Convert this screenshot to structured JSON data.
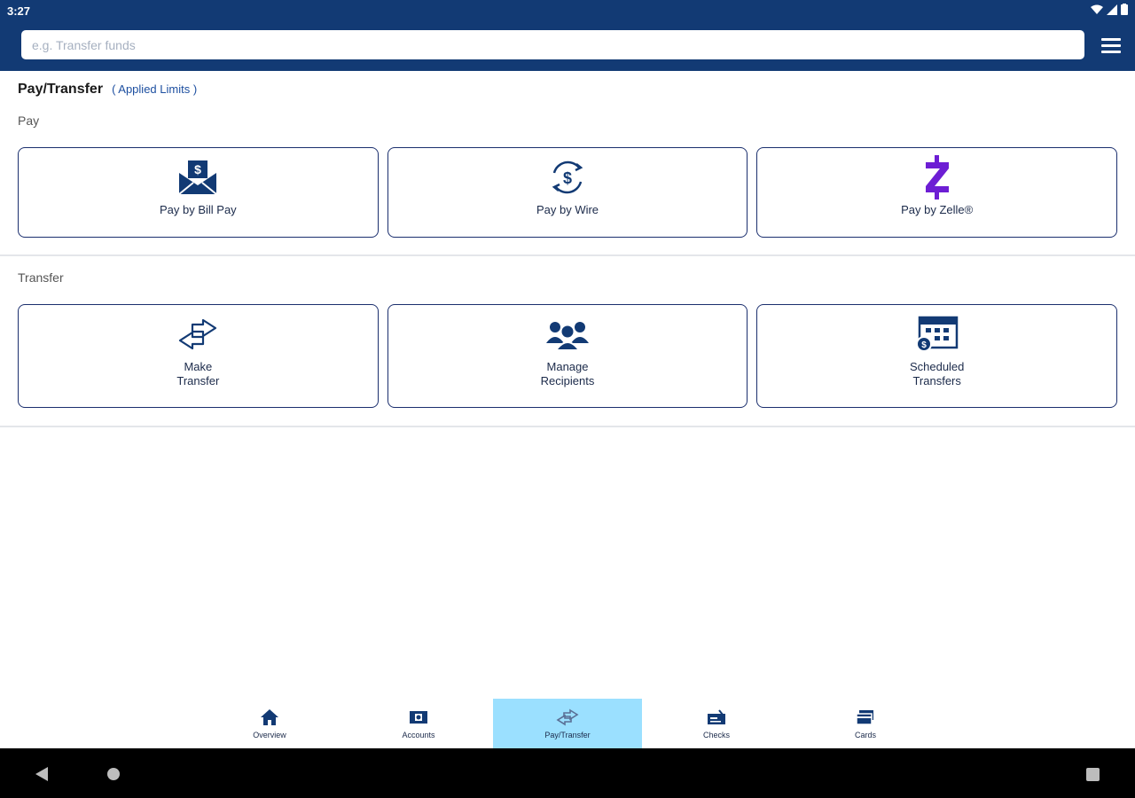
{
  "status_bar": {
    "time": "3:27"
  },
  "search": {
    "placeholder": "e.g. Transfer funds",
    "value": ""
  },
  "header": {
    "title": "Pay/Transfer",
    "limits_link": "( Applied Limits )"
  },
  "pay_section": {
    "label": "Pay",
    "tiles": [
      {
        "label": "Pay by Bill Pay",
        "icon": "bill-pay-envelope-icon"
      },
      {
        "label": "Pay by Wire",
        "icon": "wire-dollar-icon"
      },
      {
        "label": "Pay by Zelle®",
        "icon": "zelle-icon"
      }
    ]
  },
  "transfer_section": {
    "label": "Transfer",
    "tiles": [
      {
        "label": "Make\nTransfer",
        "icon": "transfer-arrows-icon"
      },
      {
        "label": "Manage\nRecipients",
        "icon": "recipients-icon"
      },
      {
        "label": "Scheduled\nTransfers",
        "icon": "calendar-icon"
      }
    ]
  },
  "bottom_nav": {
    "items": [
      {
        "label": "Overview",
        "icon": "home-icon"
      },
      {
        "label": "Accounts",
        "icon": "accounts-icon"
      },
      {
        "label": "Pay/Transfer",
        "icon": "pay-transfer-icon",
        "active": true
      },
      {
        "label": "Checks",
        "icon": "checks-icon"
      },
      {
        "label": "Cards",
        "icon": "cards-icon"
      }
    ]
  },
  "colors": {
    "brand": "#123a74",
    "tile_border": "#1b2f6e",
    "zelle": "#6d1ed4",
    "link": "#1d4fa0",
    "active_tab": "#9be0ff"
  }
}
